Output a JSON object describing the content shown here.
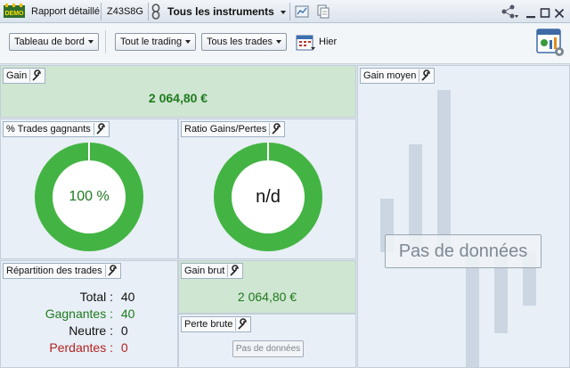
{
  "titlebar": {
    "demo_badge": "DEMO",
    "report_label": "Rapport détaillé",
    "account": "Z43S8G",
    "instruments": "Tous les instruments"
  },
  "toolbar": {
    "dashboard": "Tableau de bord",
    "trading": "Tout le trading",
    "trades": "Tous les trades",
    "date": "Hier"
  },
  "gain": {
    "title": "Gain",
    "value": "2 064,80 €"
  },
  "win_trades": {
    "title": "% Trades gagnants",
    "value": "100 %"
  },
  "ratio": {
    "title": "Ratio Gains/Pertes",
    "value": "n/d"
  },
  "avg_gain": {
    "title": "Gain moyen",
    "empty": "Pas de données"
  },
  "distribution": {
    "title": "Répartition des trades",
    "total_label": "Total :",
    "total": "40",
    "win_label": "Gagnantes :",
    "win": "40",
    "neutral_label": "Neutre :",
    "neutral": "0",
    "loss_label": "Perdantes :",
    "loss": "0"
  },
  "gross_gain": {
    "title": "Gain brut",
    "value": "2 064,80 €"
  },
  "gross_loss": {
    "title": "Perte brute",
    "empty": "Pas de données"
  },
  "colors": {
    "green": "#43b443",
    "value_green": "#1f7a1f",
    "loss_red": "#b32222"
  }
}
